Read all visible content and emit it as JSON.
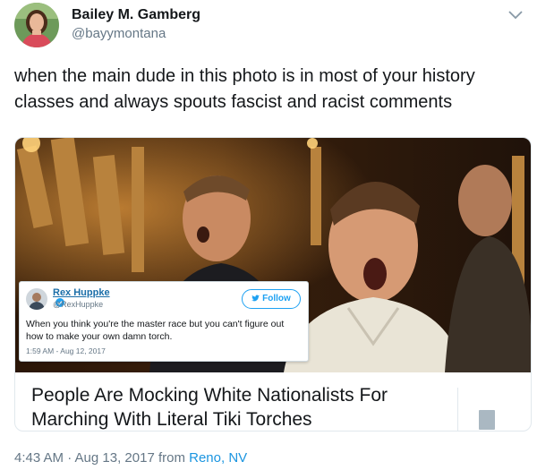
{
  "tweet": {
    "display_name": "Bailey M. Gamberg",
    "handle": "@bayymontana",
    "text": "when the main dude in this photo is in most of your history classes and always spouts fascist and racist comments",
    "time_prefix": "4:43 AM · Aug 13, 2017 from ",
    "location": "Reno, NV"
  },
  "card": {
    "headline": "People Are Mocking White Nationalists For Marching With Literal Tiki Torches",
    "embedded_tweet": {
      "name": "Rex Huppke",
      "handle": "@RexHuppke",
      "follow_label": "Follow",
      "text": "When you think you're the master race but you can't figure out how to make your own damn torch.",
      "time": "1:59 AM - Aug 12, 2017"
    }
  },
  "colors": {
    "link": "#1b95e0",
    "muted": "#657786",
    "border": "#e1e8ed",
    "twitter_blue": "#1da1f2"
  },
  "icons": {
    "menu": "chevron-down-icon",
    "verified": "verified-badge-icon",
    "follow": "twitter-bird-icon",
    "card_type": "article-icon"
  }
}
